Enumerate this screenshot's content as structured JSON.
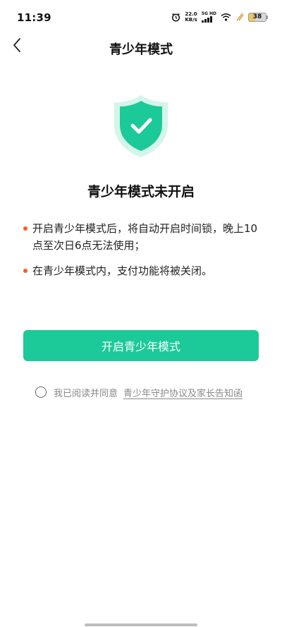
{
  "status_bar": {
    "time": "11:39",
    "network_speed_value": "22.0",
    "network_speed_unit": "KB/s",
    "network_type": "5G HD",
    "battery_level": "38",
    "icons": [
      "alarm-icon",
      "signal-icon",
      "wifi-icon",
      "charging-icon",
      "battery-icon"
    ]
  },
  "header": {
    "title": "青少年模式",
    "back_icon": "chevron-left-icon"
  },
  "main": {
    "shield_icon": "shield-check-icon",
    "status_heading": "青少年模式未开启",
    "bullets": [
      "开启青少年模式后，将自动开启时间锁，晚上10点至次日6点无法使用；",
      "在青少年模式内，支付功能将被关闭。"
    ],
    "enable_button_label": "开启青少年模式"
  },
  "agreement": {
    "prefix": "我已阅读并同意",
    "link_text": "青少年守护协议及家长告知函",
    "checked": false
  },
  "colors": {
    "accent": "#1cc998",
    "shield_light": "#d4f5ea",
    "bullet_dot": "#ff5a1f",
    "muted_text": "#888888"
  }
}
